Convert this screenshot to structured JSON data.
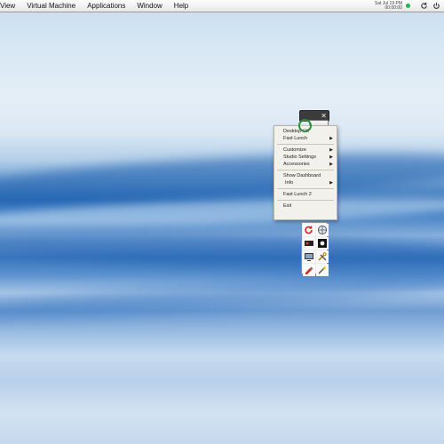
{
  "menubar": {
    "items": [
      "View",
      "Virtual Machine",
      "Applications",
      "Window",
      "Help"
    ],
    "clock": [
      "Sat Jul 19 PM",
      "00:00:00"
    ]
  },
  "context_menu": {
    "items": [
      {
        "label": "Desktop Off",
        "submenu": false
      },
      {
        "label": "Fast Lunch",
        "submenu": true
      },
      {
        "sep": true
      },
      {
        "label": "Customize",
        "submenu": true
      },
      {
        "label": "Studio Settings",
        "submenu": true
      },
      {
        "label": "Accessories",
        "submenu": true
      },
      {
        "sep": true
      },
      {
        "label": "Show Dashboard",
        "submenu": false
      },
      {
        "label": "Info",
        "submenu": true
      },
      {
        "sep": true
      },
      {
        "label": "Fast Lunch 2",
        "submenu": false
      },
      {
        "sep": true
      },
      {
        "label": "Exit",
        "submenu": false
      }
    ]
  },
  "palette": {
    "tools": [
      "undo-icon",
      "globe-icon",
      "record-icon",
      "stop-icon",
      "screen-icon",
      "tools-icon",
      "paint-icon",
      "magic-icon"
    ]
  },
  "colors": {
    "accent_green": "#2bb34a",
    "cursor_ring": "#2d8f3a"
  }
}
